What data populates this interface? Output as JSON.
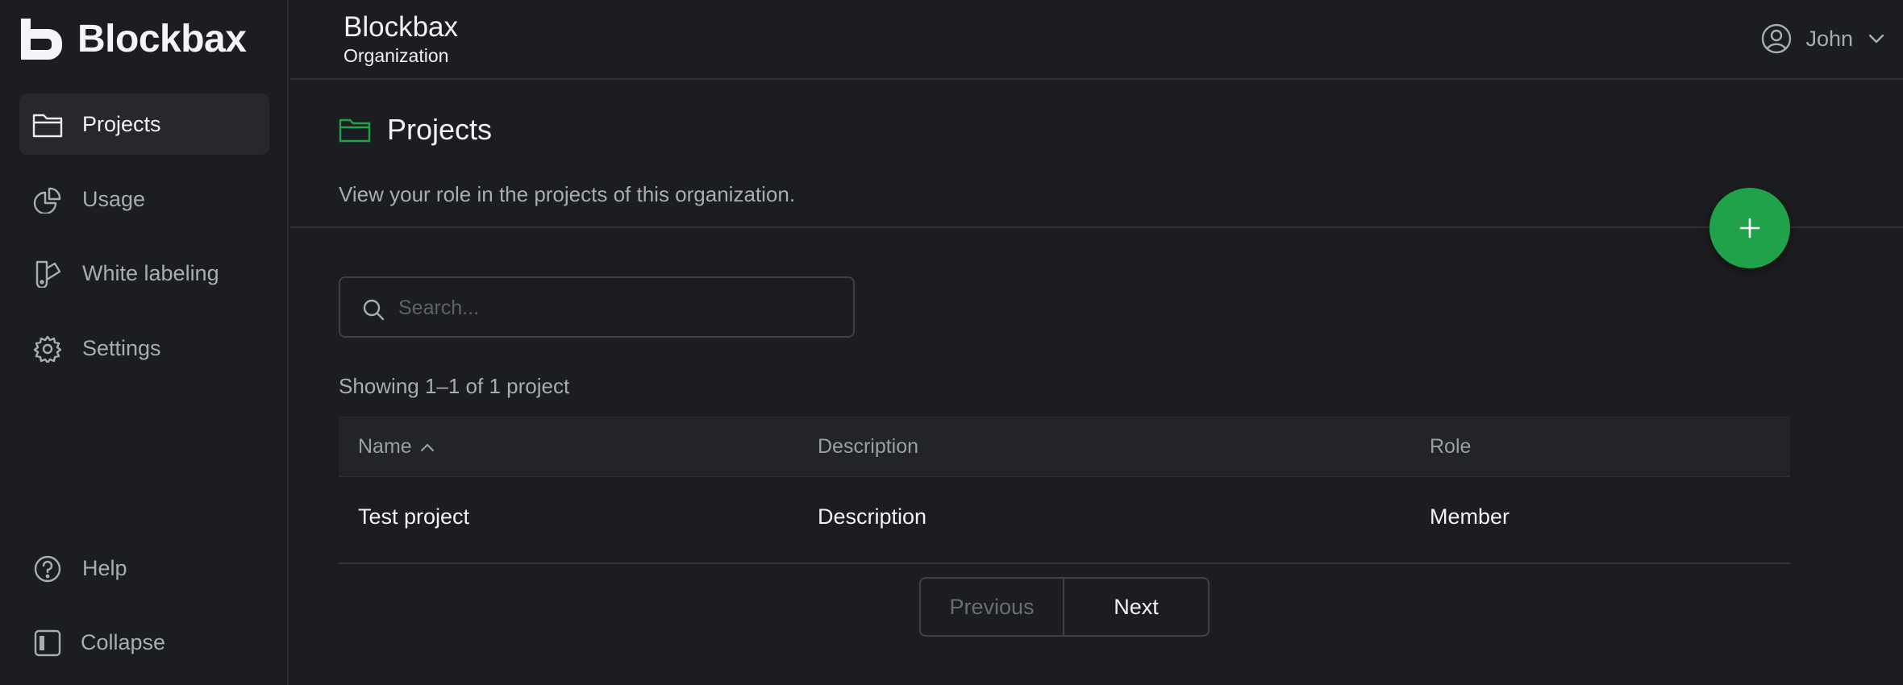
{
  "brand": {
    "name": "Blockbax",
    "accent": "#20a24a"
  },
  "sidebar": {
    "items": [
      {
        "label": "Projects",
        "icon": "folder-icon",
        "active": true
      },
      {
        "label": "Usage",
        "icon": "pie-chart-icon"
      },
      {
        "label": "White labeling",
        "icon": "swatch-icon"
      },
      {
        "label": "Settings",
        "icon": "gear-icon"
      }
    ],
    "bottom": [
      {
        "label": "Help",
        "icon": "help-circle-icon"
      },
      {
        "label": "Collapse",
        "icon": "sidebar-collapse-icon"
      }
    ]
  },
  "header": {
    "title": "Blockbax",
    "subtitle": "Organization",
    "user_name": "John"
  },
  "main": {
    "title": "Projects",
    "description": "View your role in the projects of this organization.",
    "search_placeholder": "Search...",
    "showing_text": "Showing 1–1 of 1 project",
    "table": {
      "columns": [
        "Name",
        "Description",
        "Role"
      ],
      "sort": {
        "column": "Name",
        "direction": "ascending"
      },
      "rows": [
        {
          "name": "Test project",
          "description": "Description",
          "role": "Member"
        }
      ]
    },
    "pagination": {
      "previous_label": "Previous",
      "next_label": "Next"
    }
  }
}
